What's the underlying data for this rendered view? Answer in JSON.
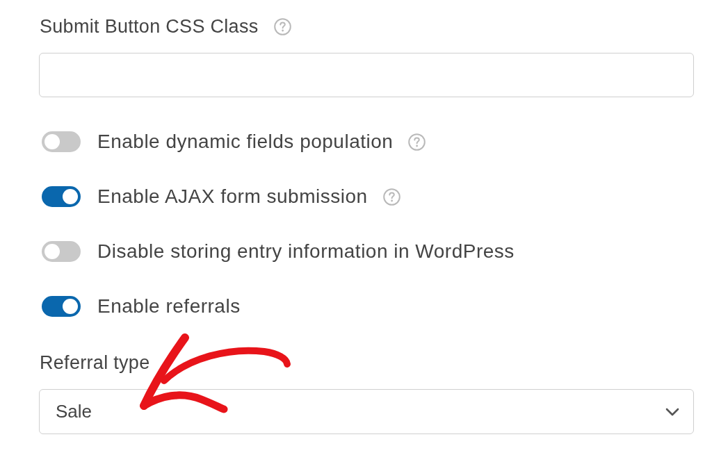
{
  "css_class_field": {
    "label": "Submit Button CSS Class",
    "has_help": true
  },
  "toggles": [
    {
      "label": "Enable dynamic fields population",
      "on": false,
      "has_help": true
    },
    {
      "label": "Enable AJAX form submission",
      "on": true,
      "has_help": true
    },
    {
      "label": "Disable storing entry information in WordPress",
      "on": false,
      "has_help": false
    },
    {
      "label": "Enable referrals",
      "on": true,
      "has_help": false
    }
  ],
  "referral_type": {
    "label": "Referral type",
    "value": "Sale"
  }
}
